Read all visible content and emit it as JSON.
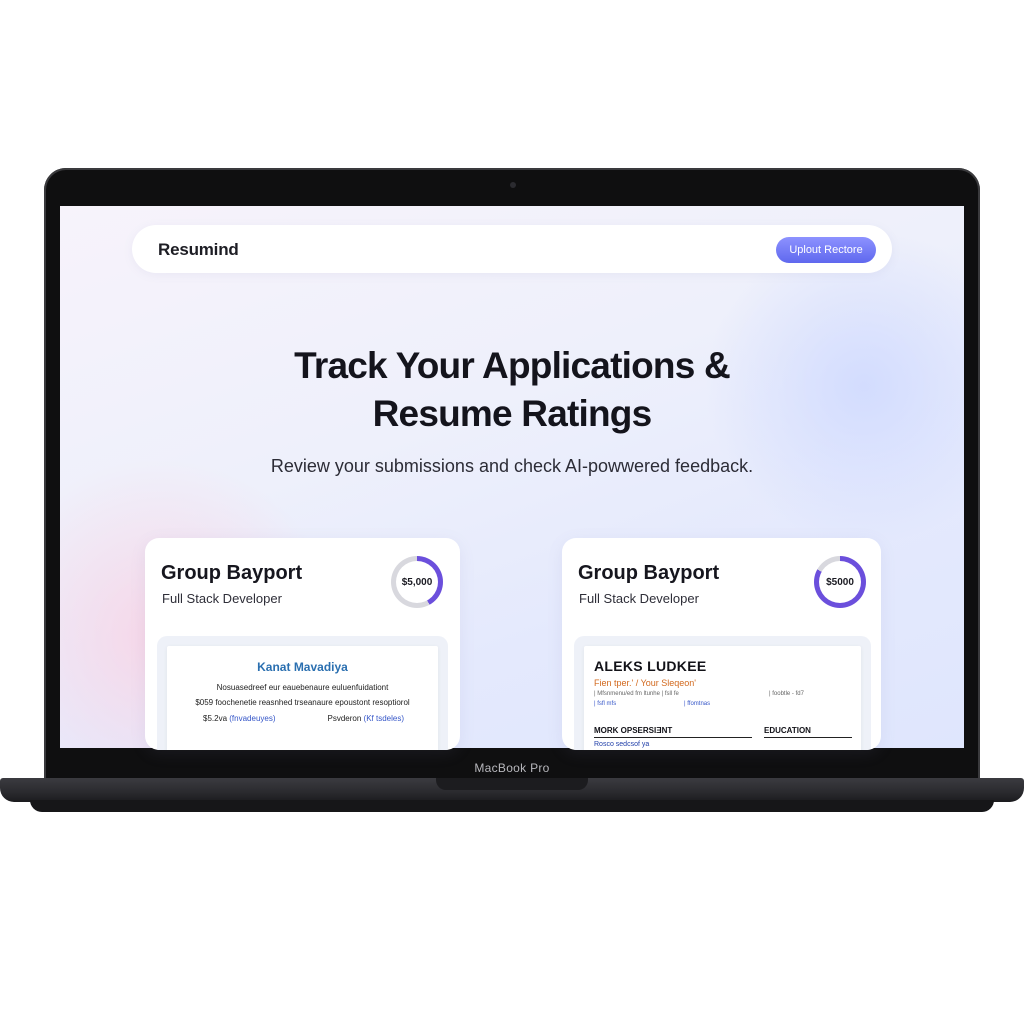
{
  "device": {
    "label": "MacBook Pro"
  },
  "navbar": {
    "logo": "Resumind",
    "upload_button": "Uplout Rectore"
  },
  "hero": {
    "title_line1": "Track Your Applications &",
    "title_line2": "Resume Ratings",
    "subtitle": "Review your submissions and check AI-powwered feedback."
  },
  "cards": [
    {
      "company": "Group Bayport",
      "role": "Full Stack Developer",
      "score": "$5,000",
      "score_fraction": 0.42,
      "preview": {
        "name": "Kanat Mavadiya",
        "line1": "Nosuasedreef eur eauebenaure euluenfuidationt",
        "line2": "$059 foochenetie reasnhed trseanaure epoustont resoptiorol",
        "left_text": "$5.2va",
        "left_link": "(fnvadeuyes)",
        "right_text": "Psvderon",
        "right_link": "(Kf tsdeles)"
      }
    },
    {
      "company": "Group Bayport",
      "role": "Full Stack Developer",
      "score": "$5000",
      "score_fraction": 0.83,
      "preview": {
        "name": "ALEKS LUDKEE",
        "title": "Fien tper.' / Your Sleqeon'",
        "contact1": "| Mfsnmenu/ed fm ltunhe | fsll fe",
        "contact2": "| foobtle - fd7",
        "link1": "| fsfl mfs",
        "link2": "| ffomtnas",
        "section1": "MORK OPSERSIƎNT",
        "section2": "EDUCATION",
        "sub1": "Rosco sedcsof ya"
      }
    }
  ],
  "colors": {
    "accent": "#6b4fdc",
    "button_gradient_top": "#8d92ff",
    "button_gradient_bottom": "#5f68ee",
    "preview_name_blue": "#2a6fb0",
    "preview_title_orange": "#d2691e"
  }
}
